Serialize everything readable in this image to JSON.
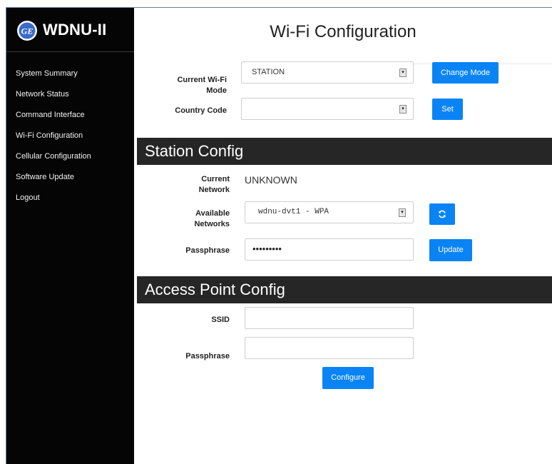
{
  "brand": {
    "title": "WDNU-II",
    "logo_icon": "ge-logo-icon"
  },
  "sidebar": {
    "items": [
      {
        "label": "System Summary"
      },
      {
        "label": "Network Status"
      },
      {
        "label": "Command Interface"
      },
      {
        "label": "Wi-Fi Configuration"
      },
      {
        "label": "Cellular Configuration"
      },
      {
        "label": "Software Update"
      },
      {
        "label": "Logout"
      }
    ]
  },
  "page": {
    "title": "Wi-Fi Configuration"
  },
  "mode": {
    "label_line1": "Current Wi-Fi",
    "label_line2": "Mode",
    "value": "STATION",
    "change_button": "Change Mode"
  },
  "country": {
    "label": "Country Code",
    "value": "",
    "set_button": "Set"
  },
  "station": {
    "section_title": "Station Config",
    "current_label_line1": "Current",
    "current_label_line2": "Network",
    "current_value": "UNKNOWN",
    "available_label_line1": "Available",
    "available_label_line2": "Networks",
    "available_value": "wdnu-dvt1 - WPA",
    "refresh_icon": "refresh-icon",
    "passphrase_label": "Passphrase",
    "passphrase_value": "•••••••••",
    "update_button": "Update"
  },
  "ap": {
    "section_title": "Access Point Config",
    "ssid_label": "SSID",
    "ssid_value": "",
    "passphrase_label": "Passphrase",
    "passphrase_value": "",
    "configure_button": "Configure"
  },
  "colors": {
    "accent": "#0a84f5",
    "sidebar": "#050505",
    "section_bar": "#262626"
  }
}
